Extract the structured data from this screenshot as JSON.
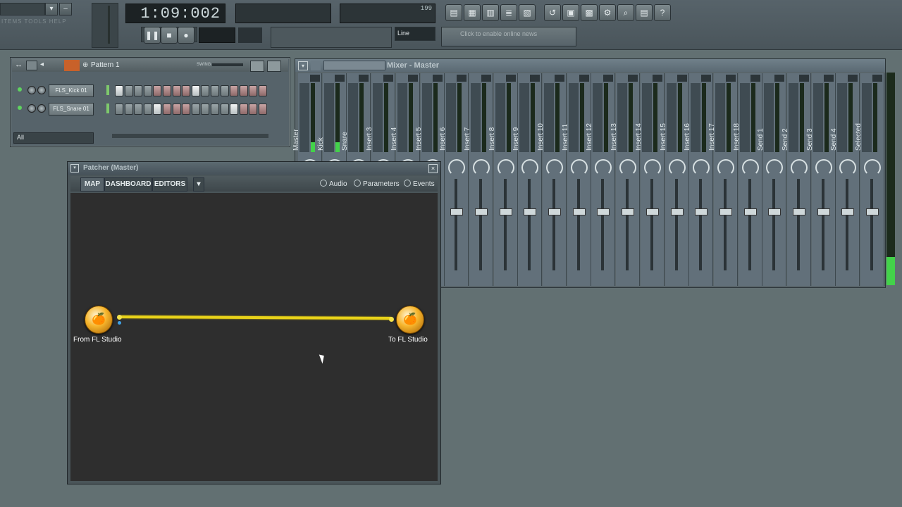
{
  "toolbar": {
    "time": "1:09:002",
    "tempo_readout": "199",
    "mode_label": "Line",
    "news_text": "Click to enable online news",
    "menu_hint": "ITEMS  TOOLS  HELP"
  },
  "step_sequencer": {
    "pattern_label": "Pattern 1",
    "swing_label": "SWING",
    "filter_label": "All",
    "channels": [
      {
        "name": "FLS_Kick 01",
        "steps": [
          1,
          0,
          0,
          0,
          0,
          0,
          0,
          0,
          1,
          0,
          0,
          0,
          0,
          0,
          0,
          0
        ]
      },
      {
        "name": "FLS_Snare 01",
        "steps": [
          0,
          0,
          0,
          0,
          1,
          0,
          0,
          0,
          0,
          0,
          0,
          0,
          1,
          0,
          0,
          0
        ]
      }
    ]
  },
  "mixer": {
    "title": "Mixer - Master",
    "strips": [
      "Master",
      "Kick",
      "Snare",
      "Insert 3",
      "Insert 4",
      "Insert 5",
      "Insert 6",
      "Insert 7",
      "Insert 8",
      "Insert 9",
      "Insert 10",
      "Insert 11",
      "Insert 12",
      "Insert 13",
      "Insert 14",
      "Insert 15",
      "Insert 16",
      "Insert 17",
      "Insert 18",
      "Send 1",
      "Send 2",
      "Send 3",
      "Send 4",
      "Selected"
    ]
  },
  "patcher": {
    "title": "Patcher (Master)",
    "tabs": {
      "map": "MAP",
      "dashboard": "DASHBOARD",
      "editors": "EDITORS"
    },
    "filters": {
      "audio": "Audio",
      "parameters": "Parameters",
      "events": "Events"
    },
    "nodes": {
      "from": "From FL Studio",
      "to": "To FL Studio"
    },
    "colors": {
      "cable": "#e8d21a",
      "canvas": "#2e2e2e"
    }
  }
}
